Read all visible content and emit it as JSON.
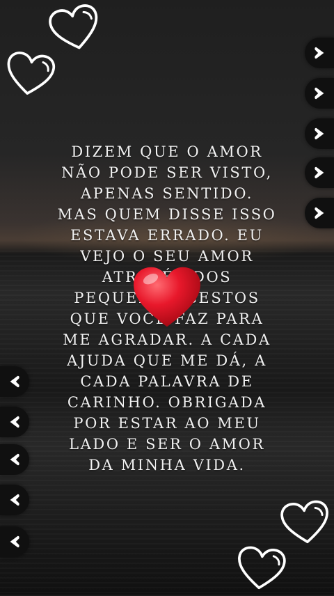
{
  "quote": {
    "lines": [
      "DIZEM QUE O AMOR",
      "NÃO PODE SER VISTO,",
      "APENAS SENTIDO.",
      "MAS QUEM DISSE ISSO",
      "ESTAVA ERRADO. EU",
      "VEJO O SEU AMOR",
      "ATRAVÉS DOS",
      "PEQUENOS GESTOS",
      "QUE VOCÊ FAZ PARA",
      "ME AGRADAR. A CADA",
      "AJUDA QUE ME DÁ, A",
      "CADA PALAVRA DE",
      "CARINHO. OBRIGADA",
      "POR ESTAR AO MEU",
      "LADO E SER O AMOR",
      "DA MINHA VIDA."
    ]
  },
  "colors": {
    "text": "#f2f2f2",
    "heart_red": "#e8182b",
    "tab_bg": "#101010"
  },
  "icons": {
    "outline_heart": "heart-outline-icon",
    "red_heart": "red-heart-icon",
    "right_arrow": "chevron-right-icon",
    "left_arrow": "chevron-left-icon"
  }
}
